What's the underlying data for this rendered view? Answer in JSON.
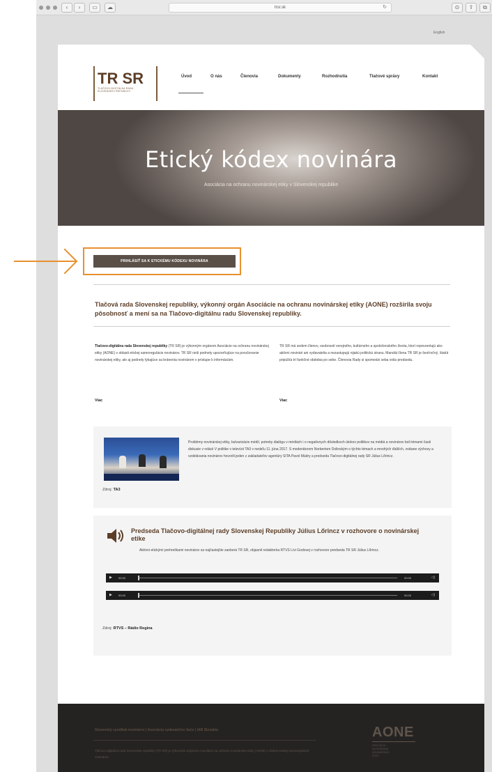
{
  "browser": {
    "url": "trsr.sk"
  },
  "language_link": "English",
  "logo": {
    "main": "TR SR",
    "sub_lines": [
      "TLAČOVO-DIGITÁLNA RADA",
      "SLOVENSKEJ REPUBLIKY"
    ]
  },
  "nav": {
    "items": [
      "Úvod",
      "O nás",
      "Členovia",
      "Dokumenty",
      "Rozhodnutia",
      "Tlačové správy",
      "Kontakt"
    ],
    "active_index": 0
  },
  "hero": {
    "title": "Etický kódex novinára",
    "subtitle": "Asociácia na ochranu novinárskej etiky v Slovenskej republike"
  },
  "cta": {
    "label": "PRIHLÁSIŤ SA K ETICKÉMU KÓDEXU NOVINÁRA",
    "highlight_color": "#e8902e"
  },
  "lead": "Tlačová rada Slovenskej republiky, výkonný orgán Asociácie na ochranu novinárskej etiky (AONE) rozšírila svoju pôsobnosť a mení sa na Tlačovo-digitálnu radu Slovenskej republiky.",
  "columns": [
    {
      "strong": "Tlačovo-digitálna rada Slovenskej republiky",
      "text": " (TR SR) je výkonným orgánom Asociácie na ochranu novinárskej etiky (AONE) v oblasti etickej samoregulácie novinárov. TR SR rieši podnety upozorňujúce na porušovanie novinárskej etiky, ale aj podnety týkajúce sa bránenia novinárom v prístupe k informáciám.",
      "more": "Viac"
    },
    {
      "strong": "",
      "text": "TR SR má sedem členov, osobností verejného, kultúrneho a spoločenského života, ktorí reprezentujú ako aktívni novinári ani vydavatelia a nezastupujú nijakú politickú stranu. Mandát člena TR SR je šesťročný, štatút pripúšťa tri funkčné obdobia po sebe. Členovia Rady si spomedzi seba volia predsedu.",
      "more": "Viac"
    }
  ],
  "video_panel": {
    "text": "Problémy novinárskej etiky, bulvarizácie médií, potreby dialógu v médiách i o negatívnych dôsledkoch útokov politikov na médiá a novinárov boli témami časti diskusie v relácii V politike v televízii TA3 v nedeľu 11. júna 2017. S moderátorom Norbertom Dolinským o týchto témach a mnohých ďalších, vrátane výchovy a vzdelávania novinárov hovorili jeden z zakladateľov agentúry SITA Pavol Múdry a predseda Tlačovo-digitálnej rady SR Július Lőrincz.",
    "source_label": "Zdroj:",
    "source": "TA3"
  },
  "audio_panel": {
    "title": "Predseda Tlačovo-digitálnej rady Slovenskej Republiky Július Lőrincz v rozhovore o novinárskej etike",
    "text": "Aktívni etickými prehreškami novinárov sa najčastejšie zaoberá TR SR, objasnil redaktorka RTVS Lívi Godovej v rozhovore predseda TR SR Július Lőrincz.",
    "players": [
      {
        "current": "00:00",
        "duration": "00:00"
      },
      {
        "current": "00:00",
        "duration": "00:00"
      }
    ],
    "source_label": "Zdroj:",
    "source": "RTVS – Rádio Regina"
  },
  "footer": {
    "links": [
      "Slovenský syndikát novinárov",
      "Asociácia vydavateľov tlače",
      "IAB Slovakia"
    ],
    "separator": " | ",
    "text": "Tlačovo-digitálna rada Slovenskej republiky (TR SR) je výkonným orgánom Asociácie na ochranu novinárskej etiky (AONE) v oblasti etickej samoregulácie novinárov.",
    "aone_logo": "AONE",
    "aone_sub": [
      "ASOCIÁCIA",
      "NA OCHRANU",
      "NOVINÁRSKEJ",
      "ETIKY"
    ]
  },
  "colors": {
    "brand_brown": "#5c3e28",
    "footer_bg": "#252322",
    "cta_bg": "#5a5048"
  }
}
